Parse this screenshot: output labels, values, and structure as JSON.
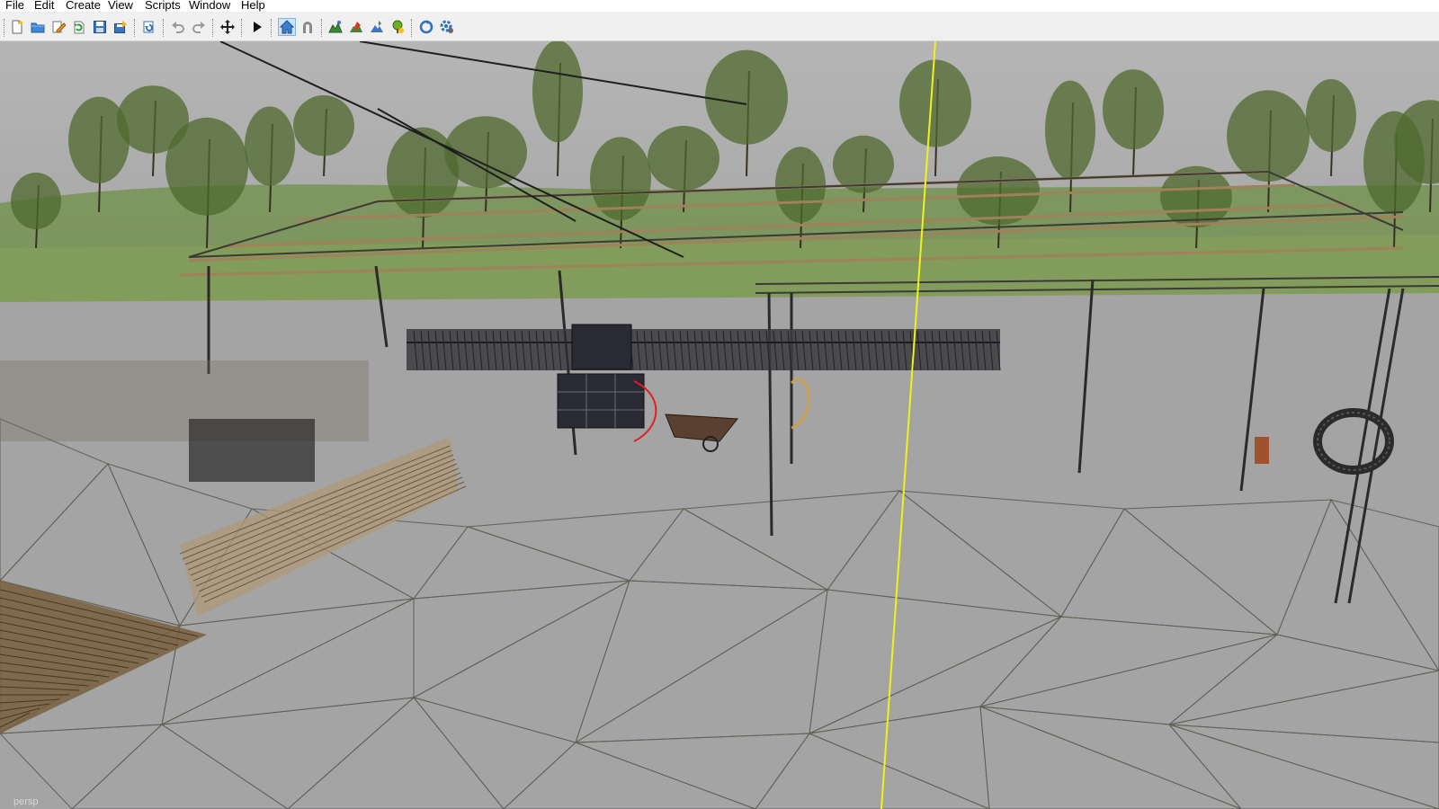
{
  "menubar": {
    "items": [
      "File",
      "Edit",
      "Create",
      "View",
      "Scripts",
      "Window",
      "Help"
    ]
  },
  "toolbar": {
    "buttons": [
      {
        "icon": "new-file-icon"
      },
      {
        "icon": "open-folder-icon"
      },
      {
        "icon": "edit-document-icon"
      },
      {
        "icon": "refresh-icon"
      },
      {
        "icon": "save-icon"
      },
      {
        "icon": "export-icon"
      },
      {
        "icon": "import-icon"
      },
      {
        "icon": "undo-icon"
      },
      {
        "icon": "redo-icon"
      },
      {
        "icon": "move-tool-icon"
      },
      {
        "icon": "play-icon"
      },
      {
        "icon": "home-view-icon",
        "active": true
      },
      {
        "icon": "magnet-icon"
      },
      {
        "icon": "terrain-paint-icon"
      },
      {
        "icon": "foliage-paint-icon"
      },
      {
        "icon": "terrain-sculpt-icon"
      },
      {
        "icon": "foliage-place-icon"
      },
      {
        "icon": "reload-scripts-icon"
      },
      {
        "icon": "settings-icon"
      }
    ]
  },
  "viewport": {
    "camera_label": "persp",
    "colors": {
      "ground": "#a4a4a4",
      "sky": "#b3b3b3",
      "grass": "#6f8f45",
      "wire": "#4a4a3c",
      "axis": "#f2f21a",
      "wood": "#a0825a",
      "tree": "#4f6a2e"
    }
  }
}
